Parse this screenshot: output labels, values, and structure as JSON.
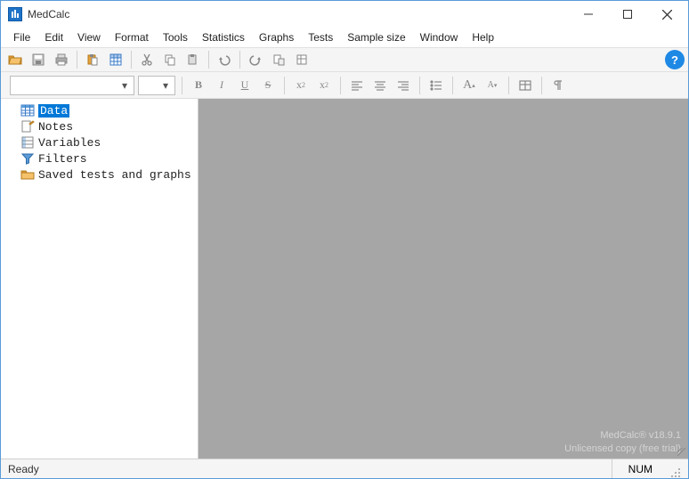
{
  "title": "MedCalc",
  "menubar": [
    "File",
    "Edit",
    "View",
    "Format",
    "Tools",
    "Statistics",
    "Graphs",
    "Tests",
    "Sample size",
    "Window",
    "Help"
  ],
  "toolbar": {
    "open": "Open",
    "save": "Save",
    "print": "Print",
    "paste": "Paste",
    "grid": "Grid",
    "cut": "Cut",
    "copy": "Copy",
    "pastealt": "Paste",
    "undo": "Undo",
    "redo": "Redo",
    "tbl1": "",
    "tbl2": "",
    "help": "?"
  },
  "format": {
    "font_name": "",
    "font_size": "",
    "bold": "B",
    "italic": "I",
    "under": "U",
    "strike": "S",
    "sub": "x",
    "sup": "x",
    "asmall": "A",
    "abig": "A"
  },
  "tree": {
    "data": "Data",
    "notes": "Notes",
    "variables": "Variables",
    "filters": "Filters",
    "saved": "Saved tests and graphs"
  },
  "watermark": {
    "line1": "MedCalc® v18.9.1",
    "line2": "Unlicensed copy (free trial)"
  },
  "status": {
    "ready": "Ready",
    "num": "NUM"
  }
}
